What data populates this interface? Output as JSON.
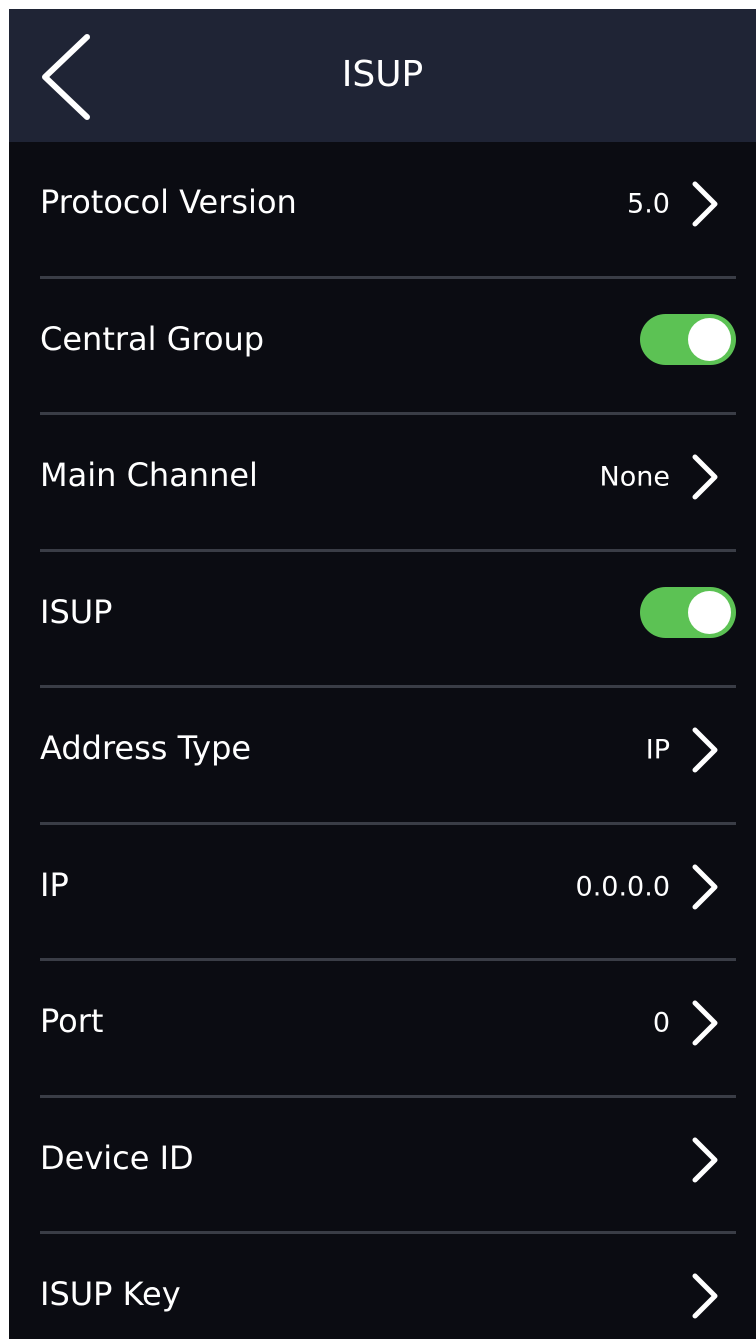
{
  "header": {
    "title": "ISUP",
    "back_icon": "chevron-left-icon"
  },
  "colors": {
    "background": "#0b0c12",
    "header": "#1f2435",
    "toggle_on": "#5cc254",
    "divider": "#3a3d46",
    "text": "#ffffff"
  },
  "settings": [
    {
      "label": "Protocol Version",
      "value": "5.0",
      "control": "chevron",
      "icon": "chevron-right-icon"
    },
    {
      "label": "Central Group",
      "control": "toggle",
      "enabled": true
    },
    {
      "label": "Main Channel",
      "value": "None",
      "control": "chevron",
      "icon": "chevron-right-icon"
    },
    {
      "label": "ISUP",
      "control": "toggle",
      "enabled": true
    },
    {
      "label": "Address Type",
      "value": "IP",
      "control": "chevron",
      "icon": "chevron-right-icon"
    },
    {
      "label": "IP",
      "value": "0.0.0.0",
      "control": "chevron",
      "icon": "chevron-right-icon"
    },
    {
      "label": "Port",
      "value": "0",
      "control": "chevron",
      "icon": "chevron-right-icon"
    },
    {
      "label": "Device ID",
      "value": "",
      "control": "chevron",
      "icon": "chevron-right-icon"
    },
    {
      "label": "ISUP Key",
      "value": "",
      "control": "chevron",
      "icon": "chevron-right-icon"
    }
  ]
}
